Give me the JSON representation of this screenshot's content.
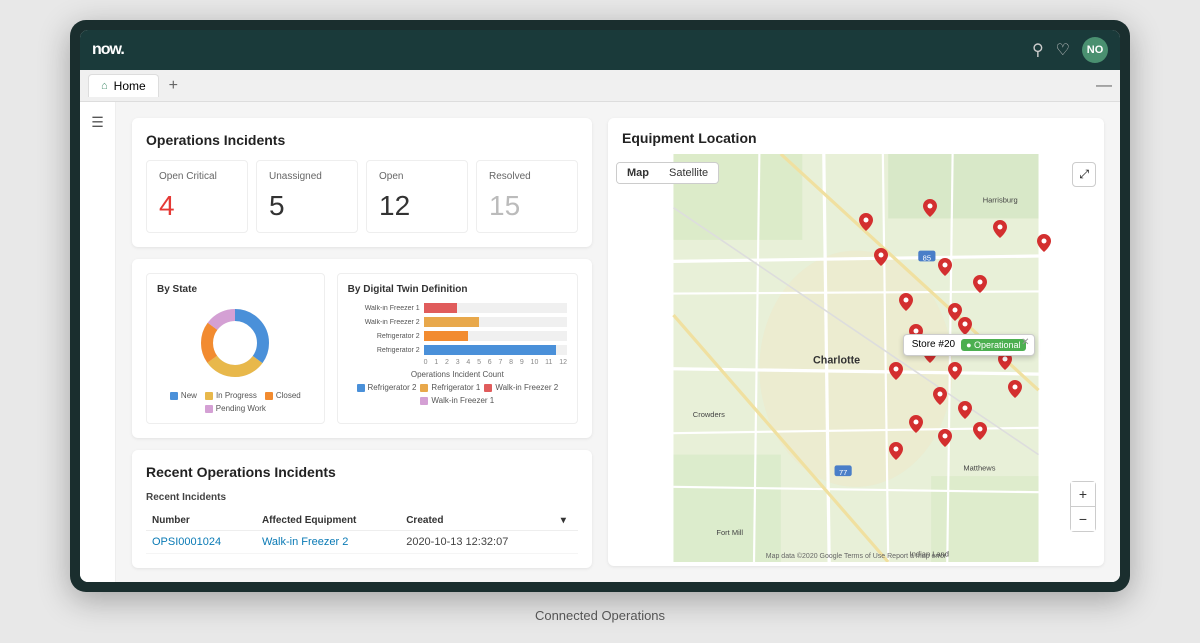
{
  "app": {
    "logo": "now.",
    "topbar": {
      "search_icon": "🔍",
      "bell_icon": "🔔",
      "avatar": "NO"
    }
  },
  "tabs": {
    "home_label": "Home",
    "add_label": "+",
    "minimize_label": "—"
  },
  "left_panel": {
    "incidents_title": "Operations Incidents",
    "stats": [
      {
        "label": "Open Critical",
        "value": "4",
        "color": "red"
      },
      {
        "label": "Unassigned",
        "value": "5",
        "color": "normal"
      },
      {
        "label": "Open",
        "value": "12",
        "color": "normal"
      },
      {
        "label": "Resolved",
        "value": "15",
        "color": "gray"
      }
    ],
    "by_state": {
      "title": "By State",
      "legend": [
        {
          "label": "New",
          "color": "#4a90d9"
        },
        {
          "label": "In Progress",
          "color": "#e8b84b"
        },
        {
          "label": "Closed",
          "color": "#f28b30"
        },
        {
          "label": "Pending Work",
          "color": "#d4a0d4"
        }
      ],
      "segments": [
        {
          "color": "#4a90d9",
          "percent": 35
        },
        {
          "color": "#e8b84b",
          "percent": 30
        },
        {
          "color": "#f28b30",
          "percent": 20
        },
        {
          "color": "#d4a0d4",
          "percent": 15
        }
      ]
    },
    "by_digital_twin": {
      "title": "By Digital Twin Definition",
      "bars": [
        {
          "label": "Walk-in Freezer 1",
          "value": 3,
          "color": "#e05c5c",
          "max": 13
        },
        {
          "label": "Walk-in Freezer 2",
          "value": 5,
          "color": "#e8a84b",
          "max": 13
        },
        {
          "label": "Refrigerator 2",
          "value": 4,
          "color": "#f28b30",
          "max": 13
        },
        {
          "label": "Refrigerator 2",
          "value": 12,
          "color": "#4a90d9",
          "max": 13
        }
      ],
      "x_labels": [
        "0",
        "1",
        "2",
        "3",
        "4",
        "5",
        "6",
        "7",
        "8",
        "9",
        "10",
        "11",
        "12"
      ],
      "x_title": "Operations Incident Count",
      "legend": [
        {
          "label": "Refrigerator 2",
          "color": "#4a90d9"
        },
        {
          "label": "Refrigerator 1",
          "color": "#e8a84b"
        },
        {
          "label": "Walk-in Freezer 2",
          "color": "#e05c5c"
        },
        {
          "label": "Walk-in Freezer 1",
          "color": "#d4a0d4"
        }
      ]
    },
    "recent_incidents": {
      "section_title": "Recent Operations Incidents",
      "sub_title": "Recent Incidents",
      "columns": [
        "Number",
        "Affected Equipment",
        "Created",
        "▾"
      ],
      "rows": [
        {
          "number": "OPSI0001024",
          "equipment": "Walk-in Freezer 2",
          "created": "2020-10-13 12:32:07"
        }
      ]
    }
  },
  "right_panel": {
    "title": "Equipment Location",
    "map_toggle": [
      "Map",
      "Satellite"
    ],
    "store_popup": {
      "label": "Store #20",
      "status": "Operational"
    }
  },
  "caption": "Connected Operations",
  "markers": [
    {
      "x": 52,
      "y": 12
    },
    {
      "x": 65,
      "y": 8
    },
    {
      "x": 79,
      "y": 14
    },
    {
      "x": 88,
      "y": 18
    },
    {
      "x": 55,
      "y": 22
    },
    {
      "x": 68,
      "y": 25
    },
    {
      "x": 75,
      "y": 30
    },
    {
      "x": 60,
      "y": 35
    },
    {
      "x": 70,
      "y": 38
    },
    {
      "x": 62,
      "y": 44
    },
    {
      "x": 72,
      "y": 42
    },
    {
      "x": 65,
      "y": 50
    },
    {
      "x": 58,
      "y": 55
    },
    {
      "x": 70,
      "y": 55
    },
    {
      "x": 75,
      "y": 48
    },
    {
      "x": 80,
      "y": 52
    },
    {
      "x": 67,
      "y": 62
    },
    {
      "x": 72,
      "y": 66
    },
    {
      "x": 62,
      "y": 70
    },
    {
      "x": 68,
      "y": 74
    },
    {
      "x": 58,
      "y": 78
    },
    {
      "x": 75,
      "y": 72
    },
    {
      "x": 82,
      "y": 60
    }
  ]
}
